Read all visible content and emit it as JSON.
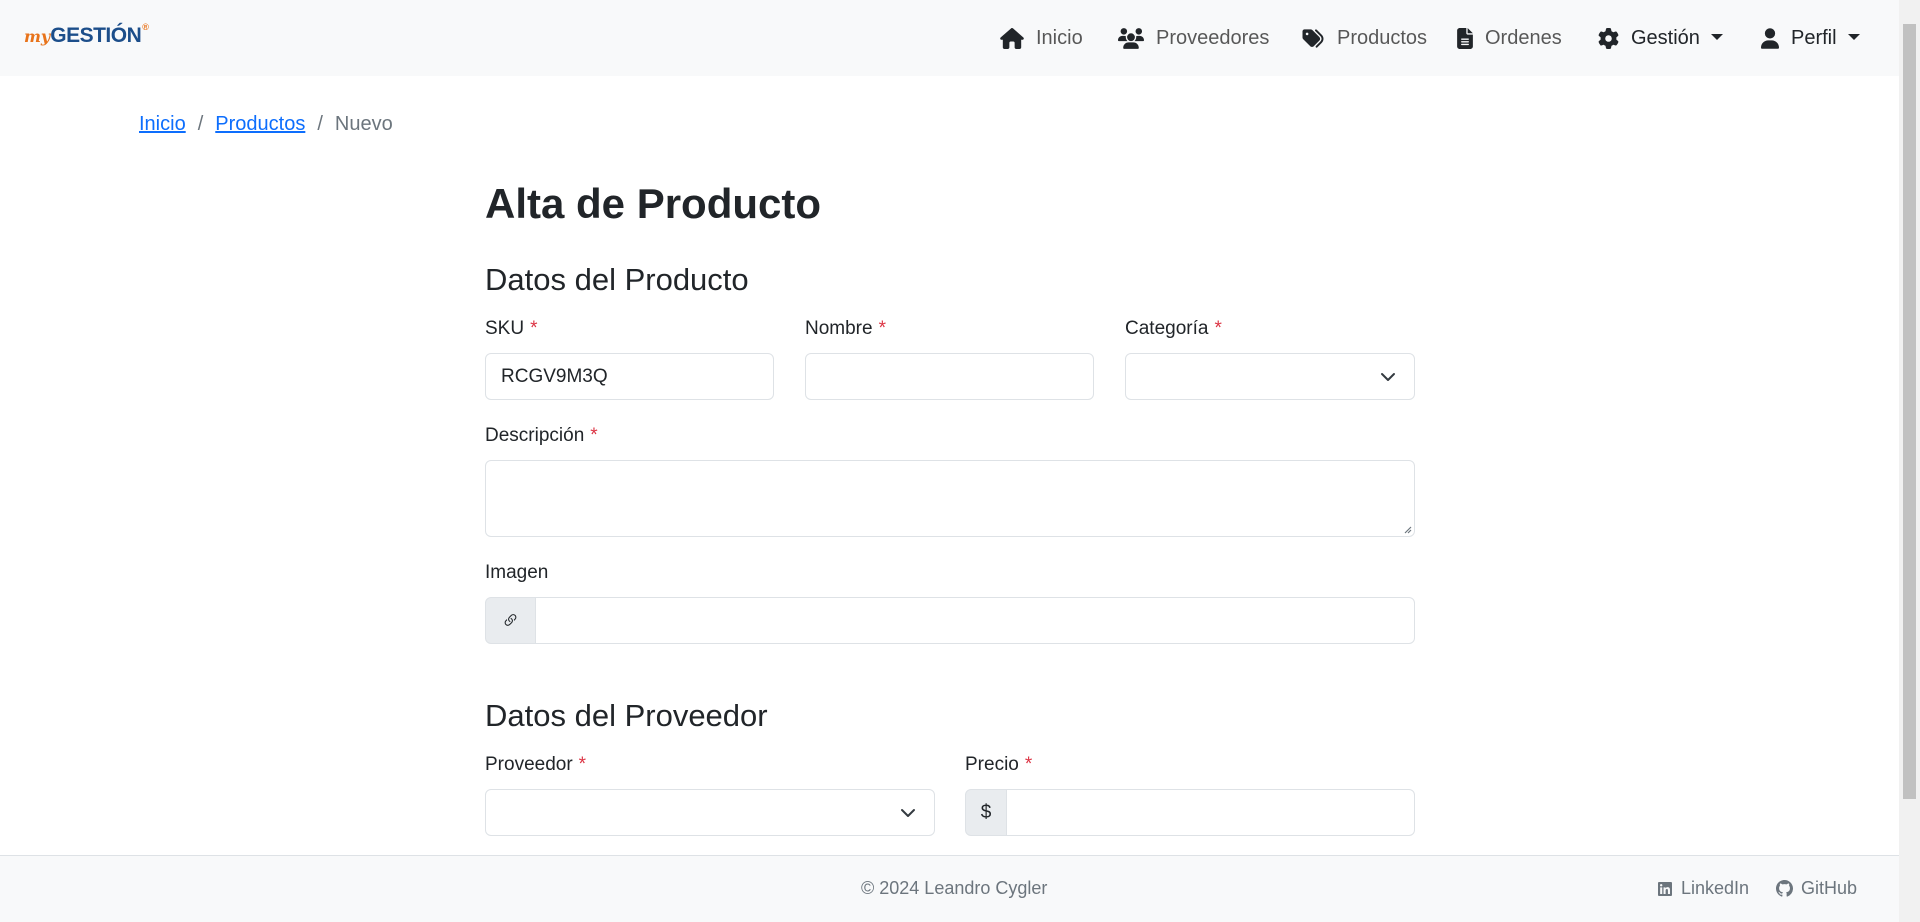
{
  "brand": {
    "my": "my",
    "name": "GESTIÓN",
    "mark": "®"
  },
  "nav": {
    "items": [
      {
        "label": "Inicio",
        "icon": "home-icon"
      },
      {
        "label": "Proveedores",
        "icon": "users-icon"
      },
      {
        "label": "Productos",
        "icon": "tags-icon"
      },
      {
        "label": "Ordenes",
        "icon": "file-icon"
      }
    ],
    "gestion": {
      "label": "Gestión",
      "icon": "gear-icon"
    },
    "perfil": {
      "label": "Perfil",
      "icon": "user-icon"
    }
  },
  "breadcrumb": {
    "home": "Inicio",
    "section": "Productos",
    "current": "Nuevo",
    "separator": "/"
  },
  "page": {
    "title": "Alta de Producto",
    "section_product": "Datos del Producto",
    "section_supplier": "Datos del Proveedor"
  },
  "form": {
    "required_mark": "*",
    "sku": {
      "label": "SKU",
      "value": "RCGV9M3Q"
    },
    "nombre": {
      "label": "Nombre",
      "value": ""
    },
    "categoria": {
      "label": "Categoría",
      "value": ""
    },
    "descripcion": {
      "label": "Descripción",
      "value": ""
    },
    "imagen": {
      "label": "Imagen",
      "value": "",
      "icon": "link-icon"
    },
    "proveedor": {
      "label": "Proveedor",
      "value": ""
    },
    "precio": {
      "label": "Precio",
      "prefix": "$",
      "value": ""
    }
  },
  "footer": {
    "copyright": "© 2024 Leandro Cygler",
    "linkedin": "LinkedIn",
    "github": "GitHub"
  },
  "colors": {
    "primary_link": "#0d6efd",
    "required": "#dc3545",
    "navbar_bg": "#f8f9fa",
    "brand_orange": "#e8731a",
    "brand_blue": "#1c4e8a"
  }
}
